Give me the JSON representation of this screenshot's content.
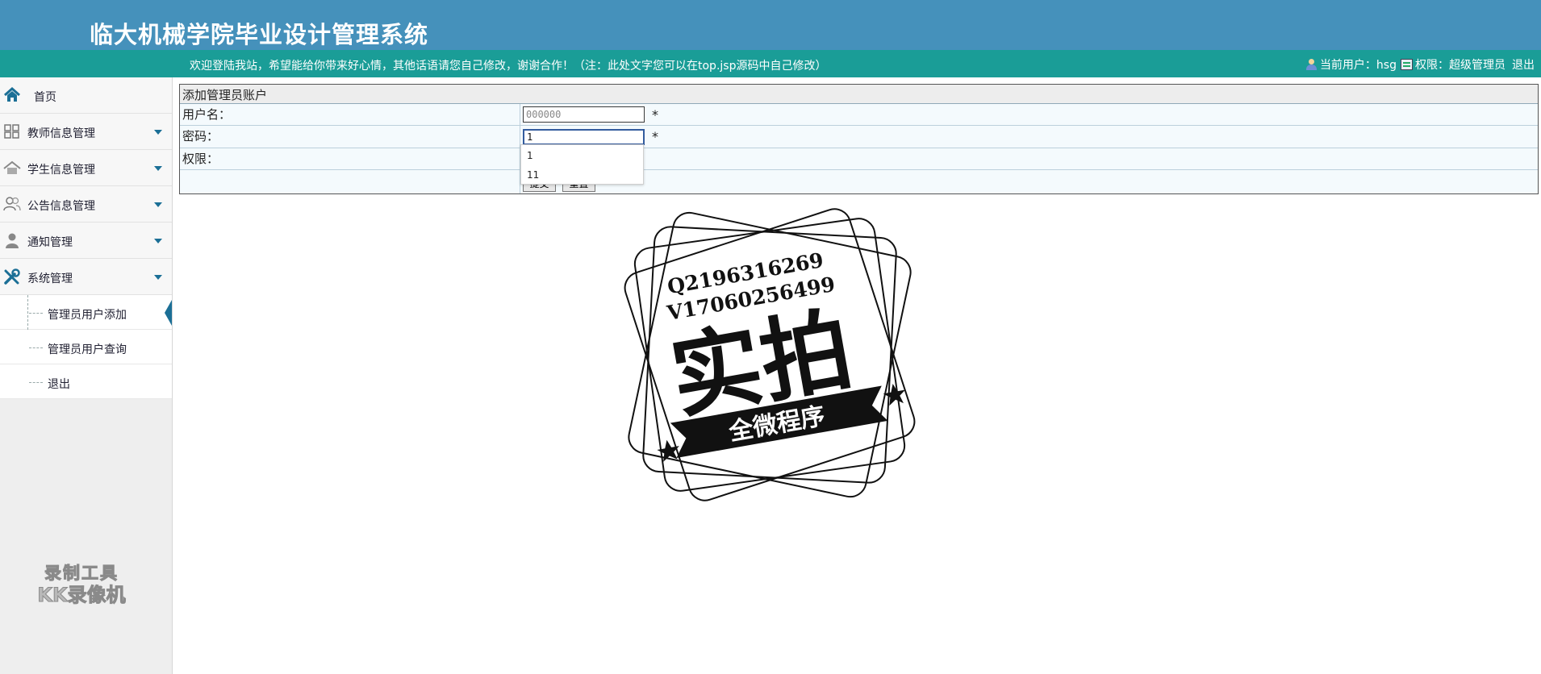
{
  "header": {
    "title": "临大机械学院毕业设计管理系统",
    "welcome": "欢迎登陆我站，希望能给你带来好心情，其他话语请您自己修改，谢谢合作！（注：此处文字您可以在top.jsp源码中自己修改）",
    "current_user_label": "当前用户：hsg",
    "permission_label": "权限：超级管理员",
    "logout_link": "退出"
  },
  "sidebar": {
    "items": [
      {
        "label": "首页",
        "icon": "home-icon"
      },
      {
        "label": "教师信息管理",
        "icon": "grid-icon"
      },
      {
        "label": "学生信息管理",
        "icon": "house-icon"
      },
      {
        "label": "公告信息管理",
        "icon": "users-icon"
      },
      {
        "label": "通知管理",
        "icon": "person-icon"
      },
      {
        "label": "系统管理",
        "icon": "wrench-icon"
      }
    ],
    "subitems": [
      {
        "label": "管理员用户添加"
      },
      {
        "label": "管理员用户查询"
      },
      {
        "label": "退出"
      }
    ]
  },
  "form": {
    "heading": "添加管理员账户",
    "username_label": "用户名：",
    "username_value": "000000",
    "password_label": "密码：",
    "password_value": "1",
    "permission_label": "权限：",
    "required_mark": "*",
    "submit_label": "提交",
    "reset_label": "重置"
  },
  "autocomplete": {
    "options": [
      "1",
      "11"
    ]
  },
  "watermark": {
    "tool_line1": "录制工具",
    "tool_line2": "KK录像机",
    "stamp_q": "Q2196316269",
    "stamp_v": "V17060256499",
    "stamp_main": "实拍",
    "stamp_ribbon": "全微程序"
  },
  "colors": {
    "header_bg": "#4591bb",
    "bar_bg": "#1a9d97",
    "accent": "#1b6f96"
  }
}
